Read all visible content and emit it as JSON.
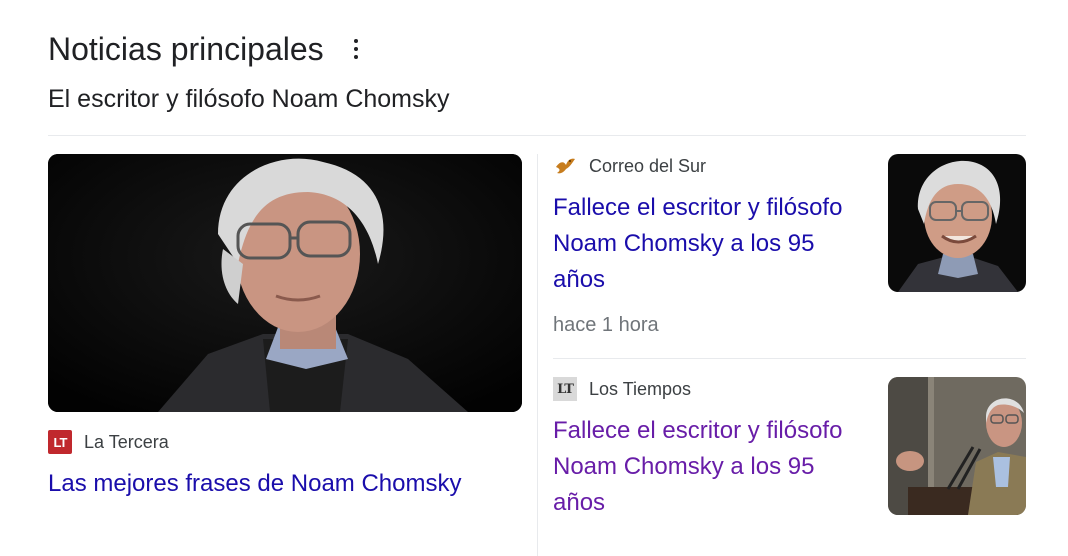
{
  "section": {
    "title": "Noticias principales",
    "subtitle": "El escritor y filósofo Noam Chomsky"
  },
  "main_story": {
    "image_icon": "person-photo",
    "source_logo_text": "LT",
    "source": "La Tercera",
    "headline": "Las mejores frases de Noam Chomsky"
  },
  "stories": [
    {
      "source_icon": "bird-logo-icon",
      "source": "Correo del Sur",
      "headline": "Fallece el escritor y filósofo Noam Chomsky a los 95 años",
      "time": "hace 1 hora"
    },
    {
      "source_logo_text": "LT",
      "source": "Los Tiempos",
      "headline": "Fallece el escritor y filósofo Noam Chomsky a los 95 años"
    }
  ],
  "colors": {
    "link": "#1a0dab",
    "visited": "#681da8",
    "la_tercera": "#c0282d"
  }
}
